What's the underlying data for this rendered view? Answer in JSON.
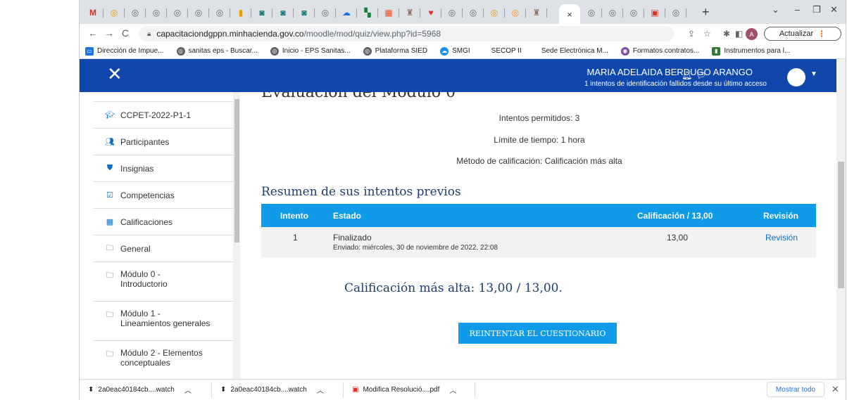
{
  "browser": {
    "url_host": "capacitaciondgppn.minhacienda.gov.co",
    "url_path": "/moodle/mod/quiz/view.php?id=5968",
    "update_label": "Actualizar",
    "profile_initial": "A",
    "active_tab_close": "×",
    "new_tab": "+"
  },
  "bookmarks": [
    {
      "label": "Dirección de Impue...",
      "color": "#1a73e8"
    },
    {
      "label": "sanitas eps - Buscar...",
      "color": "#5f6368"
    },
    {
      "label": "Inicio - EPS Sanitas...",
      "color": "#5f6368"
    },
    {
      "label": "Plataforma SIED",
      "color": "#5f6368"
    },
    {
      "label": "SMGI",
      "color": "#1a8fe3"
    },
    {
      "label": "SECOP II",
      "color": ""
    },
    {
      "label": "Sede Electrónica M...",
      "color": ""
    },
    {
      "label": "Formatos contratos...",
      "color": "#7b4aa0"
    },
    {
      "label": "Instrumentos para l...",
      "color": "#2e7d32"
    }
  ],
  "header": {
    "user_name": "MARIA ADELAIDA BERDUGO ARANGO",
    "login_note": "1 intentos de identificación fallidos desde su último acceso"
  },
  "sidebar": {
    "items": [
      {
        "label": "CCPET-2022-P1-1",
        "icon": "graduation-cap-icon"
      },
      {
        "label": "Participantes",
        "icon": "users-icon"
      },
      {
        "label": "Insignias",
        "icon": "shield-icon"
      },
      {
        "label": "Competencias",
        "icon": "checkbox-icon"
      },
      {
        "label": "Calificaciones",
        "icon": "table-icon"
      },
      {
        "label": "General",
        "icon": "folder-icon"
      },
      {
        "label": "Módulo 0 -",
        "label2": "Introductorio",
        "icon": "folder-icon"
      },
      {
        "label": "Módulo 1 -",
        "label2": "Lineamientos generales",
        "icon": "folder-icon"
      },
      {
        "label": "Módulo 2 - Elementos",
        "label2": "conceptuales",
        "icon": "folder-icon"
      }
    ]
  },
  "main": {
    "page_title_partial": "Evaluación del Módulo 0",
    "info": [
      "Intentos permitidos: 3",
      "Límite de tiempo: 1 hora",
      "Método de calificación: Calificación más alta"
    ],
    "summary_heading": "Resumen de sus intentos previos",
    "table": {
      "headers": [
        "Intento",
        "Estado",
        "Calificación / 13,00",
        "Revisión"
      ],
      "rows": [
        {
          "attempt": "1",
          "state": "Finalizado",
          "submitted": "Enviado: miércoles, 30 de noviembre de 2022, 22:08",
          "grade": "13,00",
          "review": "Revisión"
        }
      ]
    },
    "highest_grade": "Calificación más alta: 13,00 / 13,00.",
    "retry_button": "REINTENTAR EL CUESTIONARIO"
  },
  "downloads": {
    "items": [
      "2a0eac40184cb....watch",
      "2a0eac40184cb....watch",
      "Modifica Resolució....pdf"
    ],
    "show_all": "Mostrar todo"
  },
  "colors": {
    "moodle_header": "#0f47ad",
    "table_header": "#0f9be8",
    "heading_text": "#1f3b6e"
  }
}
